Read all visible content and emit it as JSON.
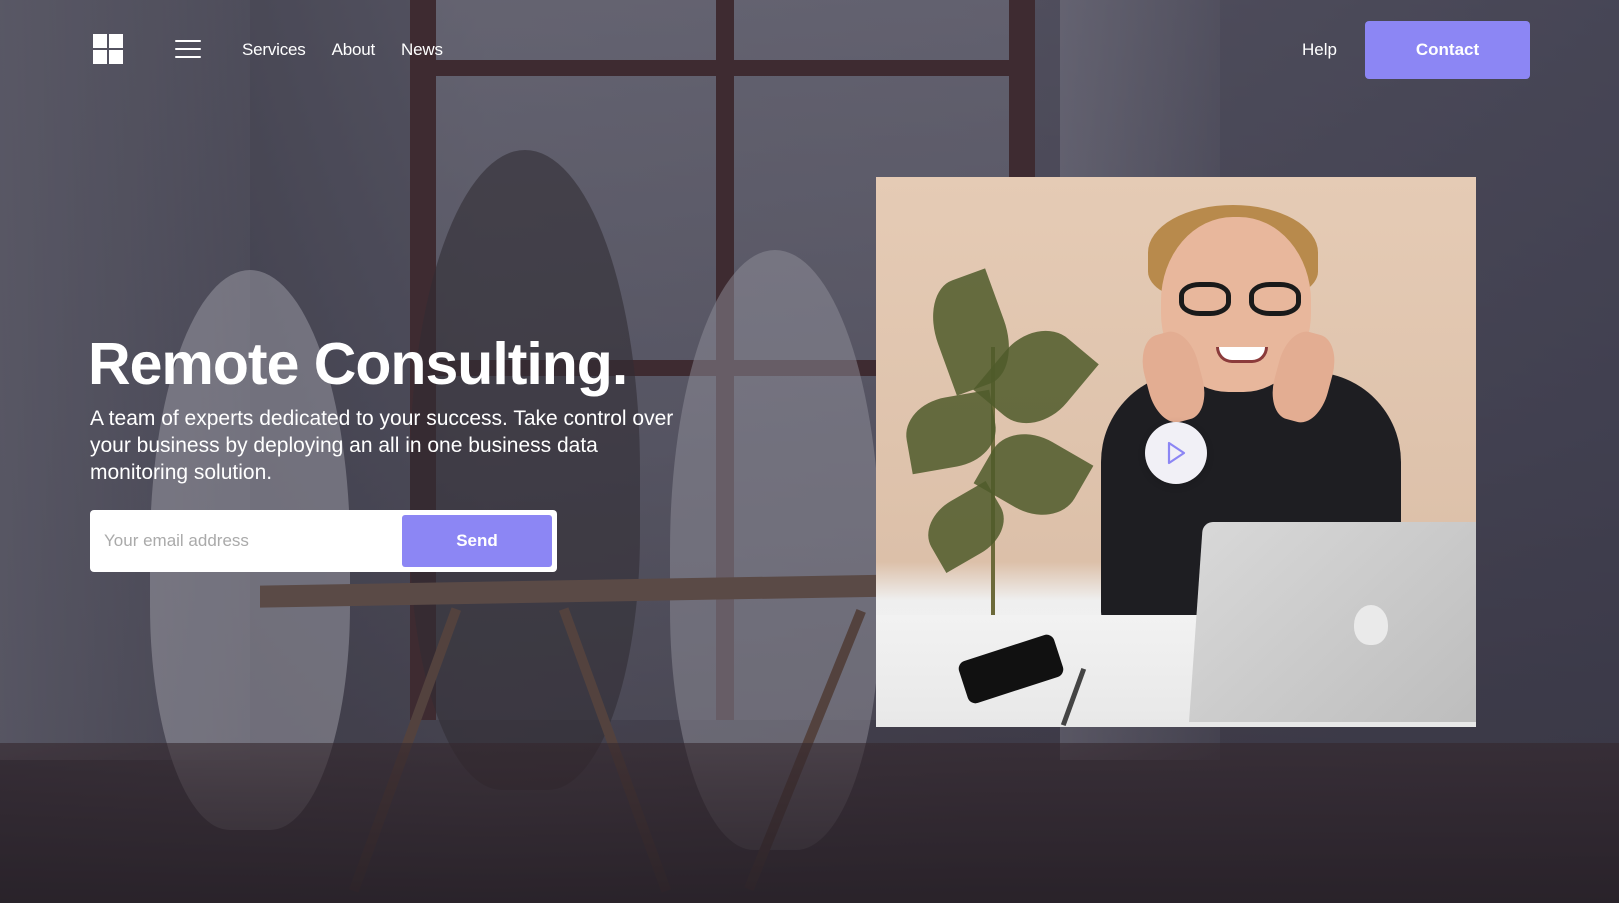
{
  "header": {
    "logo_icon": "four-squares-logo-icon",
    "menu_icon": "hamburger-menu-icon",
    "nav_items": [
      {
        "label": "Services"
      },
      {
        "label": "About"
      },
      {
        "label": "News"
      }
    ],
    "help_label": "Help",
    "contact_label": "Contact"
  },
  "hero": {
    "title": "Remote Consulting.",
    "subtitle": "A team of experts dedicated to your success. Take control over your business by deploying an all in one business data monitoring solution.",
    "email_placeholder": "Your email address",
    "email_value": "",
    "send_label": "Send"
  },
  "video": {
    "play_icon": "play-icon"
  },
  "colors": {
    "accent": "#8c86f4",
    "text_on_dark": "#ffffff",
    "overlay": "#3a3a45",
    "input_bg": "#ffffff",
    "placeholder": "#aaaaaa"
  }
}
